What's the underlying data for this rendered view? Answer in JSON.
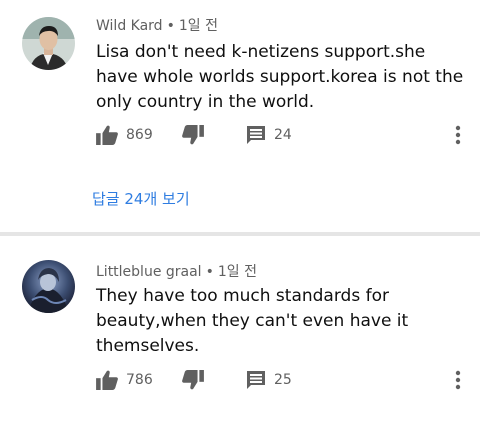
{
  "comments": [
    {
      "author": "Wild Kard",
      "separator": "•",
      "time": "1일 전",
      "text": "Lisa don't need k-netizens support.she have whole worlds support.korea is not the only country in the world.",
      "likes": "869",
      "reply_count": "24",
      "replies_link": "답글 24개 보기"
    },
    {
      "author": "Littleblue graal",
      "separator": "•",
      "time": "1일 전",
      "text": "They have too much standards for beauty,when they can't even have it themselves.",
      "likes": "786",
      "reply_count": "25"
    }
  ],
  "icons": {
    "like": "thumb-up-icon",
    "dislike": "thumb-down-icon",
    "reply": "comment-icon",
    "more": "more-vert-icon"
  },
  "colors": {
    "link": "#2f7de1",
    "meta": "#606060",
    "icon": "#606060",
    "divider": "#e5e5e5"
  }
}
